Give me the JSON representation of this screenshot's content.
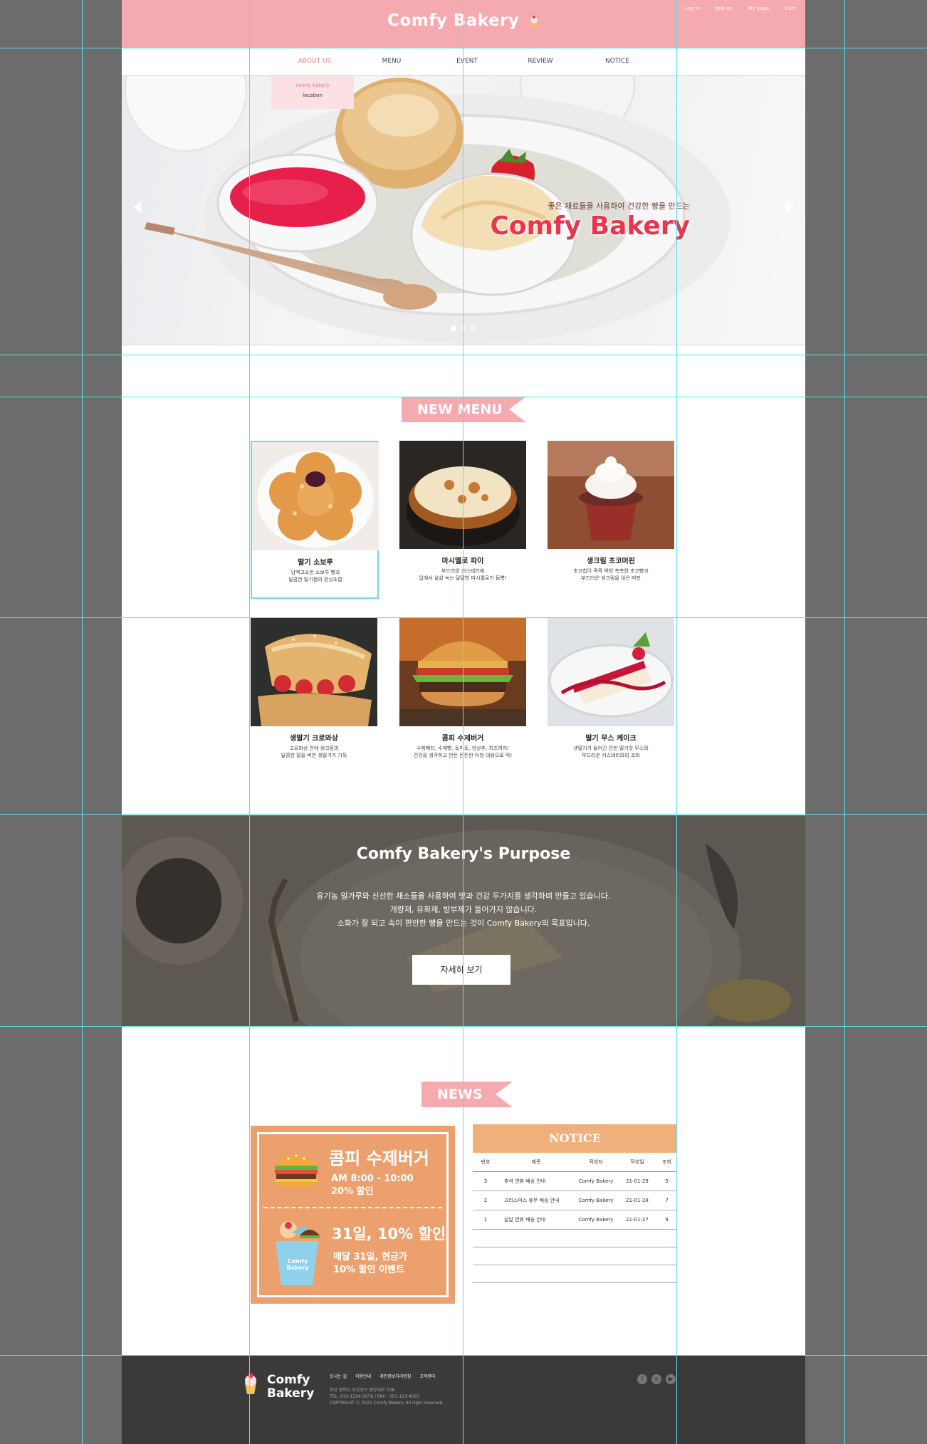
{
  "header": {
    "logo": "Comfy Bakery",
    "util_links": [
      "Log in",
      "Join us",
      "My page",
      "Cart"
    ]
  },
  "nav": {
    "items": [
      "ABOUT US",
      "MENU",
      "EVENT",
      "REVIEW",
      "NOTICE"
    ],
    "active": "ABOUT US",
    "submenu": [
      "comfy bakery",
      "location"
    ]
  },
  "hero": {
    "tagline": "좋은 재료들을 사용하여 건강한 빵을 만드는",
    "name": "Comfy Bakery",
    "slide_count": 3,
    "active_slide": 1
  },
  "new_menu": {
    "title": "NEW MENU",
    "items": [
      {
        "name": "딸기 소보루",
        "desc1": "담백고소한 소보루 빵과",
        "desc2": "달콤한 딸기잼의 환상조합"
      },
      {
        "name": "마시멜로 파이",
        "desc1": "부드러운 커스테라에",
        "desc2": "입에서 살살 녹는 달달한 마시멜로가 듬뿍!"
      },
      {
        "name": "생크림 초코머핀",
        "desc1": "초코칩이 콕콕 박힌 촉촉한 초코빵과",
        "desc2": "부드러운 생크림을 얹은 머핀"
      },
      {
        "name": "생딸기 크로와상",
        "desc1": "고르퍄상 안에 생크림과",
        "desc2": "달콤한 딸을 버븐 생딸기가 가득"
      },
      {
        "name": "콤피 수제버거",
        "desc1": "수제패티, 수제빵, 토마토, 양상추, 치즈까지!",
        "desc2": "건강을 생각하고 만든 든든한 아침 대용으로 딱!"
      },
      {
        "name": "딸기 무스 케이크",
        "desc1": "생딸기가 들어간 진한 딸기맛 무스와",
        "desc2": "부드러운 커스테라와의 조화"
      }
    ]
  },
  "purpose": {
    "title": "Comfy Bakery's Purpose",
    "lines": [
      "유기농 밀가루와 신선한 채소들을 사용하여 맛과 건강 두가지를 생각하며 만들고 있습니다.",
      "개량제, 유화제, 방부제가 들어가지 않습니다.",
      "소화가 잘 되고 속이 편안한 빵을 만드는 것이 Comfy Bakery의 목표입니다."
    ],
    "button": "자세히 보기"
  },
  "news": {
    "title": "NEWS",
    "event": {
      "title1": "콤피 수제버거",
      "line1": "AM 8:00 - 10:00",
      "line2": "20% 할인",
      "title2": "31일, 10% 할인",
      "line3": "매달 31일, 현금가",
      "line4": "10% 할인 이벤트",
      "cup_text": "Comfy Bakery"
    },
    "notice": {
      "title": "NOTICE",
      "headers": [
        "번호",
        "제목",
        "작성자",
        "작성일",
        "조회"
      ],
      "rows": [
        [
          "3",
          "추석 연휴 배송 안내",
          "Comfy Bakery",
          "21-01-29",
          "5"
        ],
        [
          "2",
          "크리스마스 휴무 배송 안내",
          "Comfy Bakery",
          "21-01-28",
          "7"
        ],
        [
          "1",
          "설날 연휴 배송 안내",
          "Comfy Bakery",
          "21-01-27",
          "9"
        ]
      ]
    }
  },
  "footer": {
    "logo_line1": "Comfy",
    "logo_line2": "Bakery",
    "links": [
      "오시는 길",
      "이용안내",
      "개인정보처리방침",
      "고객센터"
    ],
    "address": "부산 광역시 부산진구 중앙대로 708",
    "contact": "TEL: 010-1234-5678  /  FAX : 051-123-4567",
    "copyright": "COPYRIGHT © 2021 Comfy Bakery. All right reserved."
  },
  "colors": {
    "brand_pink": "#f5aab0",
    "accent_red": "#e8364d",
    "guide_cyan": "#59e0ea",
    "event_orange": "#eca06d",
    "notice_orange": "#efb07b",
    "footer_dark": "#3a3a3a"
  }
}
